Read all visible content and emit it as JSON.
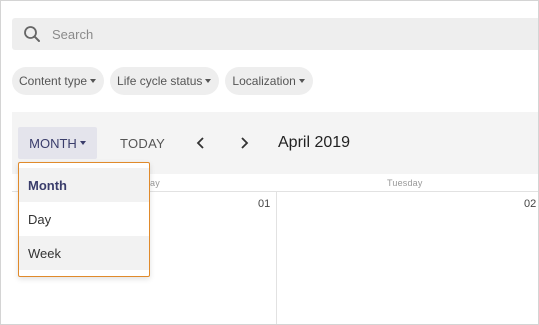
{
  "search": {
    "placeholder": "Search"
  },
  "filters": [
    {
      "label": "Content type"
    },
    {
      "label": "Life cycle status"
    },
    {
      "label": "Localization"
    }
  ],
  "toolbar": {
    "view_label": "MONTH",
    "today_label": "TODAY",
    "prev_icon": "chevron-left-icon",
    "next_icon": "chevron-right-icon",
    "period_title": "April 2019"
  },
  "grid": {
    "weekdays": [
      "Monday",
      "Tuesday"
    ],
    "visible_weekday_fragment": "ay",
    "days": [
      "01",
      "02"
    ]
  },
  "dropdown": {
    "items": [
      {
        "label": "Month",
        "selected": true
      },
      {
        "label": "Day",
        "selected": false
      },
      {
        "label": "Week",
        "selected": false
      }
    ]
  },
  "colors": {
    "accent_border": "#e08a2b",
    "view_button_bg": "#e4e4ec",
    "view_button_text": "#3a3d6b"
  }
}
